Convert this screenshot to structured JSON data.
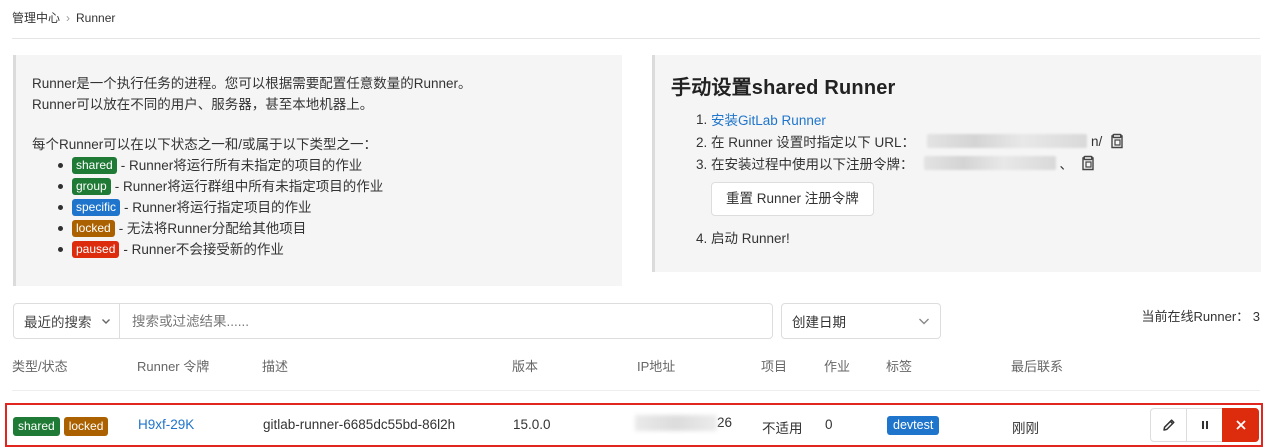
{
  "breadcrumb": {
    "root": "管理中心",
    "current": "Runner"
  },
  "info": {
    "line1": "Runner是一个执行任务的进程。您可以根据需要配置任意数量的Runner。",
    "line2": "Runner可以放在不同的用户、服务器，甚至本地机器上。",
    "line3": "每个Runner可以在以下状态之一和/或属于以下类型之一：",
    "types": [
      {
        "badge": "shared",
        "text": "- Runner将运行所有未指定的项目的作业",
        "color": "#1f7a36"
      },
      {
        "badge": "group",
        "text": "- Runner将运行群组中所有未指定项目的作业",
        "color": "#1f7a36"
      },
      {
        "badge": "specific",
        "text": "- Runner将运行指定项目的作业",
        "color": "#1f75cb"
      },
      {
        "badge": "locked",
        "text": "- 无法将Runner分配给其他项目",
        "color": "#ab6100"
      },
      {
        "badge": "paused",
        "text": "- Runner不会接受新的作业",
        "color": "#dd2b0e"
      }
    ]
  },
  "setup": {
    "title": "手动设置shared Runner",
    "step1_num": "1.",
    "step1_link": "安装GitLab Runner",
    "step2": "2. 在 Runner 设置时指定以下 URL：",
    "step2_tail": "n/",
    "step3": "3. 在安装过程中使用以下注册令牌：",
    "step3_tail": "、",
    "reset_button": "重置 Runner 注册令牌",
    "step4": "4. 启动 Runner!"
  },
  "filter": {
    "recent_label": "最近的搜索",
    "search_placeholder": "搜索或过滤结果......",
    "sort_label": "创建日期",
    "online_count": "当前在线Runner：  3"
  },
  "table": {
    "headers": [
      "类型/状态",
      "Runner 令牌",
      "描述",
      "版本",
      "IP地址",
      "项目",
      "作业",
      "标签",
      "最后联系"
    ],
    "row": {
      "badges": [
        {
          "label": "shared",
          "color": "#1f7a36"
        },
        {
          "label": "locked",
          "color": "#ab6100"
        }
      ],
      "token": "H9xf-29K",
      "description": "gitlab-runner-6685dc55bd-86l2h",
      "version": "15.0.0",
      "ip_tail": "26",
      "projects": "不适用",
      "jobs": "0",
      "tag": "devtest",
      "last_contact": "刚刚"
    }
  },
  "icons": [
    "chevron-down-icon",
    "chevron-right-icon",
    "copy-icon",
    "pencil-icon",
    "pause-icon",
    "close-icon"
  ]
}
